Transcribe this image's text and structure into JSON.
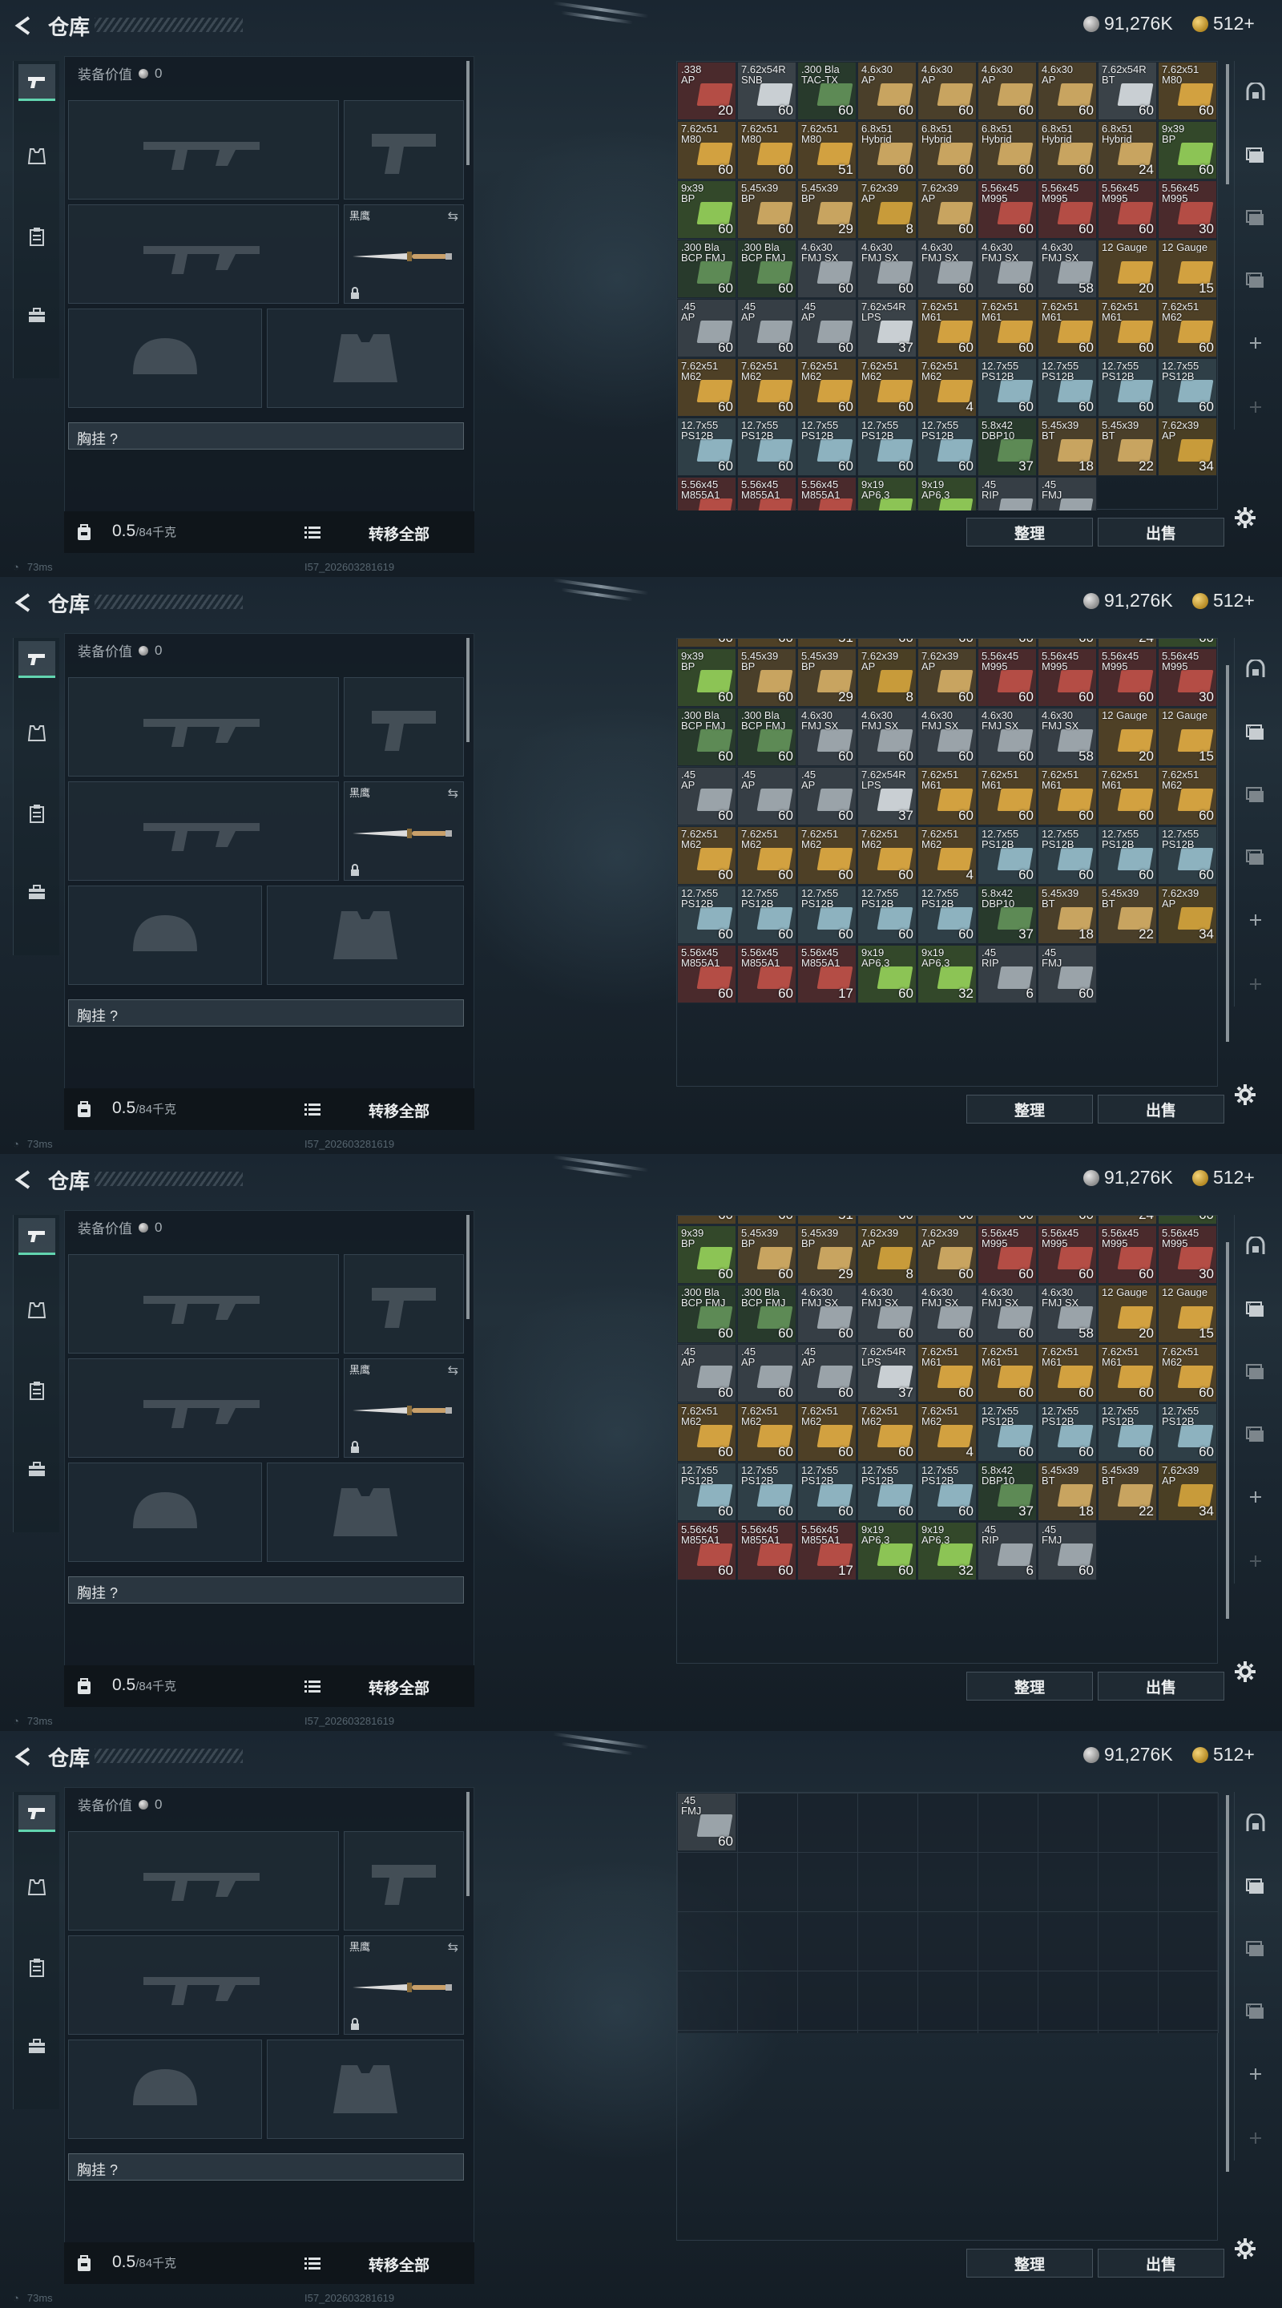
{
  "header": {
    "title": "仓库",
    "silver": "91,276K",
    "gold": "512+"
  },
  "equipment": {
    "value_label": "装备价值",
    "value": "0",
    "melee_label": "黑鹰",
    "chest_rig_label": "胸挂 ?",
    "weight": "0.5",
    "weight_max": "/84千克",
    "transfer_all": "转移全部"
  },
  "actions": {
    "sort": "整理",
    "sell": "出售"
  },
  "status": {
    "ping": "73ms",
    "build": "I57_202603281619"
  },
  "stash_items": [
    {
      "n": ".338",
      "s": "AP",
      "c": "20",
      "k": "red"
    },
    {
      "n": "7.62x54R",
      "s": "SNB",
      "c": "60",
      "k": "white"
    },
    {
      "n": ".300 Bla",
      "s": "TAC-TX",
      "c": "60",
      "k": "green"
    },
    {
      "n": "4.6x30",
      "s": "AP",
      "c": "60",
      "k": "tan"
    },
    {
      "n": "4.6x30",
      "s": "AP",
      "c": "60",
      "k": "tan"
    },
    {
      "n": "4.6x30",
      "s": "AP",
      "c": "60",
      "k": "tan"
    },
    {
      "n": "4.6x30",
      "s": "AP",
      "c": "60",
      "k": "tan"
    },
    {
      "n": "7.62x54R",
      "s": "BT",
      "c": "60",
      "k": "white"
    },
    {
      "n": "7.62x51",
      "s": "M80",
      "c": "60",
      "k": "gold"
    },
    {
      "n": "7.62x51",
      "s": "M80",
      "c": "60",
      "k": "gold"
    },
    {
      "n": "7.62x51",
      "s": "M80",
      "c": "60",
      "k": "gold"
    },
    {
      "n": "7.62x51",
      "s": "M80",
      "c": "51",
      "k": "gold"
    },
    {
      "n": "6.8x51",
      "s": "Hybrid",
      "c": "60",
      "k": "tan"
    },
    {
      "n": "6.8x51",
      "s": "Hybrid",
      "c": "60",
      "k": "tan"
    },
    {
      "n": "6.8x51",
      "s": "Hybrid",
      "c": "60",
      "k": "tan"
    },
    {
      "n": "6.8x51",
      "s": "Hybrid",
      "c": "60",
      "k": "tan"
    },
    {
      "n": "6.8x51",
      "s": "Hybrid",
      "c": "24",
      "k": "tan"
    },
    {
      "n": "9x39",
      "s": "BP",
      "c": "60",
      "k": "lime"
    },
    {
      "n": "9x39",
      "s": "BP",
      "c": "60",
      "k": "lime"
    },
    {
      "n": "5.45x39",
      "s": "BP",
      "c": "60",
      "k": "tan"
    },
    {
      "n": "5.45x39",
      "s": "BP",
      "c": "29",
      "k": "tan"
    },
    {
      "n": "7.62x39",
      "s": "AP",
      "c": "8",
      "k": "brass"
    },
    {
      "n": "7.62x39",
      "s": "AP",
      "c": "60",
      "k": "tan"
    },
    {
      "n": "5.56x45",
      "s": "M995",
      "c": "60",
      "k": "red"
    },
    {
      "n": "5.56x45",
      "s": "M995",
      "c": "60",
      "k": "red"
    },
    {
      "n": "5.56x45",
      "s": "M995",
      "c": "60",
      "k": "red"
    },
    {
      "n": "5.56x45",
      "s": "M995",
      "c": "30",
      "k": "red"
    },
    {
      "n": ".300 Bla",
      "s": "BCP FMJ",
      "c": "60",
      "k": "green"
    },
    {
      "n": ".300 Bla",
      "s": "BCP FMJ",
      "c": "60",
      "k": "green"
    },
    {
      "n": "4.6x30",
      "s": "FMJ SX",
      "c": "60",
      "k": "gray"
    },
    {
      "n": "4.6x30",
      "s": "FMJ SX",
      "c": "60",
      "k": "gray"
    },
    {
      "n": "4.6x30",
      "s": "FMJ SX",
      "c": "60",
      "k": "gray"
    },
    {
      "n": "4.6x30",
      "s": "FMJ SX",
      "c": "60",
      "k": "gray"
    },
    {
      "n": "4.6x30",
      "s": "FMJ SX",
      "c": "58",
      "k": "gray"
    },
    {
      "n": "12 Gauge",
      "s": "",
      "c": "20",
      "k": "gold"
    },
    {
      "n": "12 Gauge",
      "s": "",
      "c": "15",
      "k": "gold"
    },
    {
      "n": ".45",
      "s": "AP",
      "c": "60",
      "k": "gray"
    },
    {
      "n": ".45",
      "s": "AP",
      "c": "60",
      "k": "gray"
    },
    {
      "n": ".45",
      "s": "AP",
      "c": "60",
      "k": "gray"
    },
    {
      "n": "7.62x54R",
      "s": "LPS",
      "c": "37",
      "k": "white"
    },
    {
      "n": "7.62x51",
      "s": "M61",
      "c": "60",
      "k": "gold"
    },
    {
      "n": "7.62x51",
      "s": "M61",
      "c": "60",
      "k": "gold"
    },
    {
      "n": "7.62x51",
      "s": "M61",
      "c": "60",
      "k": "gold"
    },
    {
      "n": "7.62x51",
      "s": "M61",
      "c": "60",
      "k": "gold"
    },
    {
      "n": "7.62x51",
      "s": "M62",
      "c": "60",
      "k": "gold"
    },
    {
      "n": "7.62x51",
      "s": "M62",
      "c": "60",
      "k": "gold"
    },
    {
      "n": "7.62x51",
      "s": "M62",
      "c": "60",
      "k": "gold"
    },
    {
      "n": "7.62x51",
      "s": "M62",
      "c": "60",
      "k": "gold"
    },
    {
      "n": "7.62x51",
      "s": "M62",
      "c": "60",
      "k": "gold"
    },
    {
      "n": "7.62x51",
      "s": "M62",
      "c": "4",
      "k": "gold"
    },
    {
      "n": "12.7x55",
      "s": "PS12B",
      "c": "60",
      "k": "teal"
    },
    {
      "n": "12.7x55",
      "s": "PS12B",
      "c": "60",
      "k": "teal"
    },
    {
      "n": "12.7x55",
      "s": "PS12B",
      "c": "60",
      "k": "teal"
    },
    {
      "n": "12.7x55",
      "s": "PS12B",
      "c": "60",
      "k": "teal"
    },
    {
      "n": "12.7x55",
      "s": "PS12B",
      "c": "60",
      "k": "teal"
    },
    {
      "n": "12.7x55",
      "s": "PS12B",
      "c": "60",
      "k": "teal"
    },
    {
      "n": "12.7x55",
      "s": "PS12B",
      "c": "60",
      "k": "teal"
    },
    {
      "n": "12.7x55",
      "s": "PS12B",
      "c": "60",
      "k": "teal"
    },
    {
      "n": "12.7x55",
      "s": "PS12B",
      "c": "60",
      "k": "teal"
    },
    {
      "n": "5.8x42",
      "s": "DBP10",
      "c": "37",
      "k": "green"
    },
    {
      "n": "5.45x39",
      "s": "BT",
      "c": "18",
      "k": "tan"
    },
    {
      "n": "5.45x39",
      "s": "BT",
      "c": "22",
      "k": "tan"
    },
    {
      "n": "7.62x39",
      "s": "AP",
      "c": "34",
      "k": "brass"
    },
    {
      "n": "5.56x45",
      "s": "M855A1",
      "c": "60",
      "k": "red"
    },
    {
      "n": "5.56x45",
      "s": "M855A1",
      "c": "60",
      "k": "red"
    },
    {
      "n": "5.56x45",
      "s": "M855A1",
      "c": "17",
      "k": "red"
    },
    {
      "n": "9x19",
      "s": "AP6.3",
      "c": "60",
      "k": "lime"
    },
    {
      "n": "9x19",
      "s": "AP6.3",
      "c": "32",
      "k": "lime"
    },
    {
      "n": ".45",
      "s": "RIP",
      "c": "6",
      "k": "gray"
    },
    {
      "n": ".45",
      "s": "FMJ",
      "c": "60",
      "k": "gray"
    }
  ],
  "last_item": {
    "n": ".45",
    "s": "FMJ",
    "c": "60",
    "k": "gray"
  }
}
